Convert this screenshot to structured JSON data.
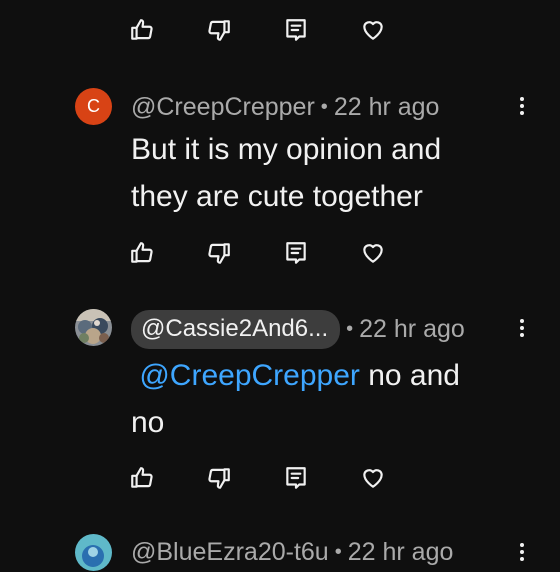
{
  "colors": {
    "background": "#0f0f0f",
    "text_primary": "#f1f1f1",
    "text_secondary": "#aaaaaa",
    "mention_blue": "#3ea6ff",
    "avatar_c": "#d84315",
    "pill_background": "#3d3d3d"
  },
  "actions": {
    "icons": [
      "thumbs-up-icon",
      "thumbs-down-icon",
      "reply-icon",
      "heart-icon"
    ]
  },
  "comments": [
    {
      "avatar_letter": "C",
      "author": "@CreepCrepper",
      "separator": "•",
      "time": "22 hr ago",
      "text_line1": "But it is my opinion and",
      "text_line2": "they are cute together"
    },
    {
      "author": "@Cassie2And6...",
      "separator": "•",
      "time": "22 hr ago",
      "mention": "@CreepCrepper",
      "text_after_mention": " no and",
      "text_line2": "no"
    },
    {
      "author": "@BlueEzra20-t6u",
      "separator": "•",
      "time": "22 hr ago"
    }
  ]
}
